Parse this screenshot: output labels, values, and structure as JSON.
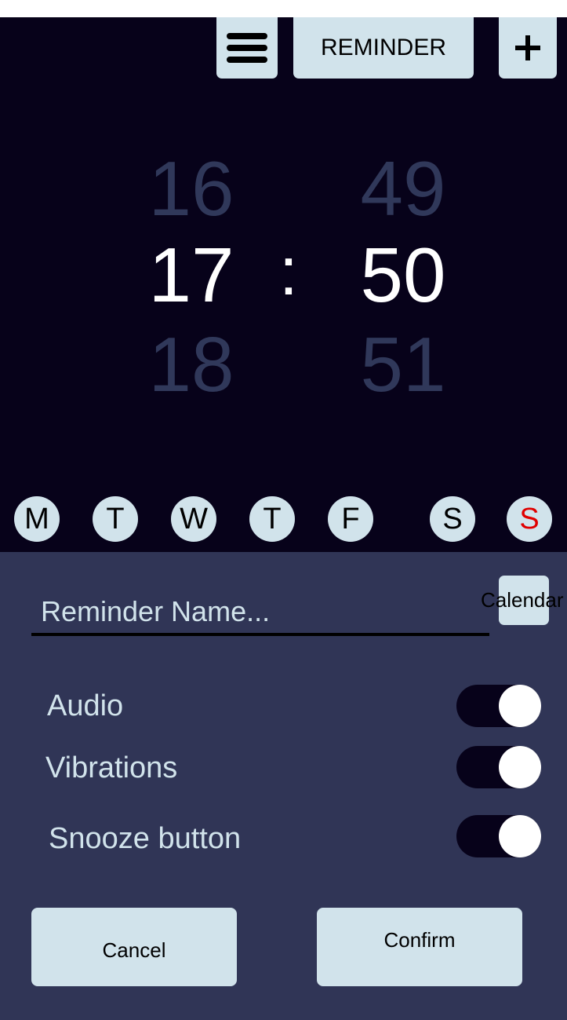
{
  "header": {
    "menu_icon": "hamburger-menu-icon",
    "title": "REMINDER",
    "add_icon": "plus-icon"
  },
  "time_picker": {
    "hours": {
      "previous": "16",
      "selected": "17",
      "next": "18"
    },
    "separator": ":",
    "minutes": {
      "previous": "49",
      "selected": "50",
      "next": "51"
    }
  },
  "days": [
    {
      "label": "M"
    },
    {
      "label": "T"
    },
    {
      "label": "W"
    },
    {
      "label": "T"
    },
    {
      "label": "F"
    },
    {
      "label": "S"
    },
    {
      "label": "S"
    }
  ],
  "form": {
    "calendar_label": "Calendar",
    "name_placeholder": "Reminder Name...",
    "name_value": ""
  },
  "settings": [
    {
      "label": "Audio",
      "enabled": true
    },
    {
      "label": "Vibrations",
      "enabled": true
    },
    {
      "label": "Snooze button",
      "enabled": true
    }
  ],
  "actions": {
    "cancel_label": "Cancel",
    "confirm_label": "Confirm"
  },
  "colors": {
    "background_dark": "#07021a",
    "panel": "#303556",
    "button": "#d1e3eb",
    "dim_number": "#30385a",
    "sunday": "#e00000"
  }
}
